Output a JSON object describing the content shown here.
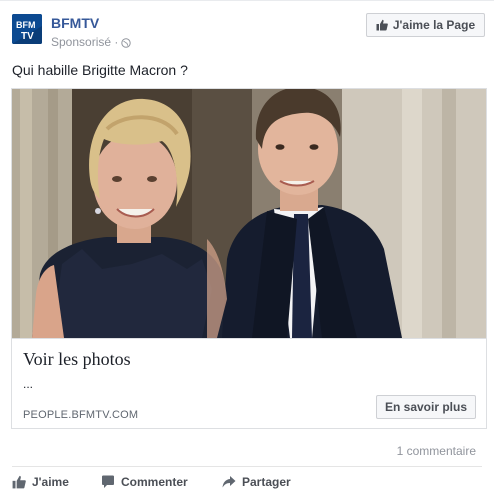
{
  "header": {
    "page_name": "BFMTV",
    "sponsored_label": "Sponsorisé ·",
    "privacy_icon": "globe-icon",
    "avatar_text_top": "BFM",
    "avatar_text_bottom": "TV",
    "like_page_label": "J'aime la Page"
  },
  "post": {
    "text": "Qui habille Brigitte Macron ?"
  },
  "card": {
    "image_icon": "photo-image",
    "title": "Voir les photos",
    "description": "...",
    "domain": "PEOPLE.BFMTV.COM",
    "cta_label": "En savoir plus"
  },
  "footer": {
    "comments_count": "1 commentaire",
    "actions": [
      {
        "label": "J'aime",
        "icon": "thumbs-up-icon"
      },
      {
        "label": "Commenter",
        "icon": "comment-icon"
      },
      {
        "label": "Partager",
        "icon": "share-icon"
      }
    ]
  },
  "colors": {
    "brand_blue": "#365899",
    "avatar_blue": "#0c4a91",
    "muted_text": "#90949c",
    "button_text": "#4b4f56"
  }
}
